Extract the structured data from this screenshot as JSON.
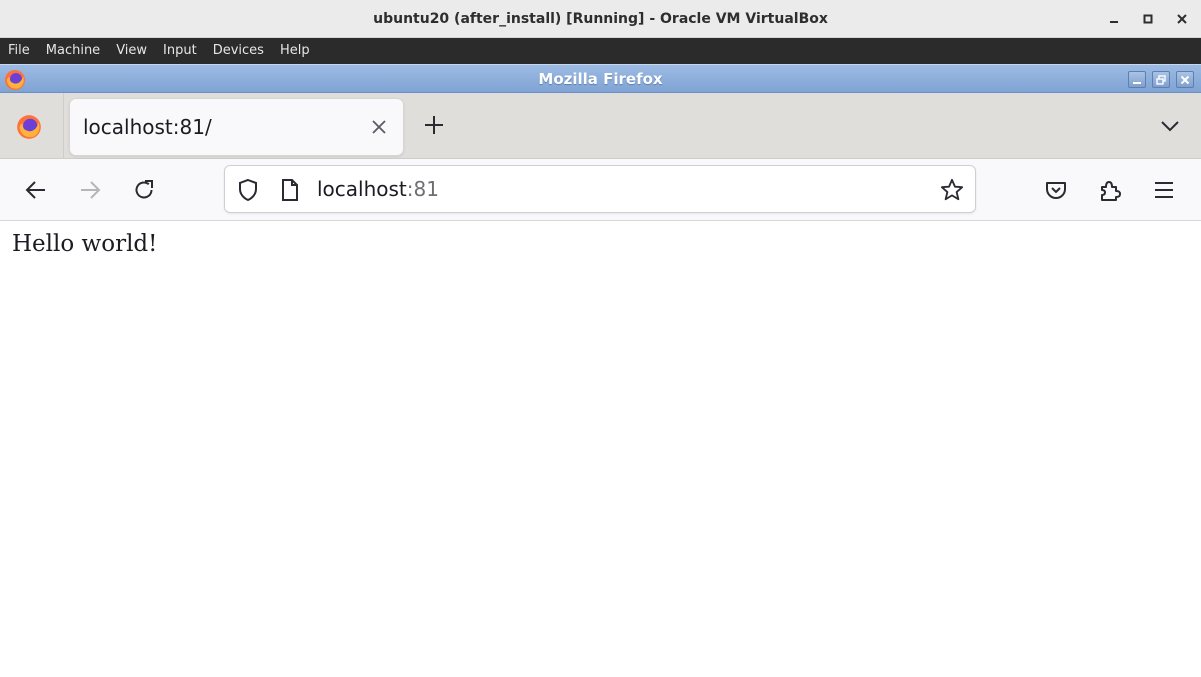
{
  "host_window": {
    "title": "ubuntu20 (after_install) [Running] - Oracle VM VirtualBox",
    "menu": [
      "File",
      "Machine",
      "View",
      "Input",
      "Devices",
      "Help"
    ]
  },
  "guest_window": {
    "title": "Mozilla Firefox"
  },
  "browser": {
    "tabs": [
      {
        "label": "localhost:81/",
        "active": true
      }
    ],
    "url": {
      "host": "localhost",
      "port": ":81"
    }
  },
  "page": {
    "text": "Hello world!"
  },
  "colors": {
    "guest_titlebar": "#7fa3d4",
    "tabstrip": "#e0dedb",
    "toolbar": "#f9f9fb"
  }
}
